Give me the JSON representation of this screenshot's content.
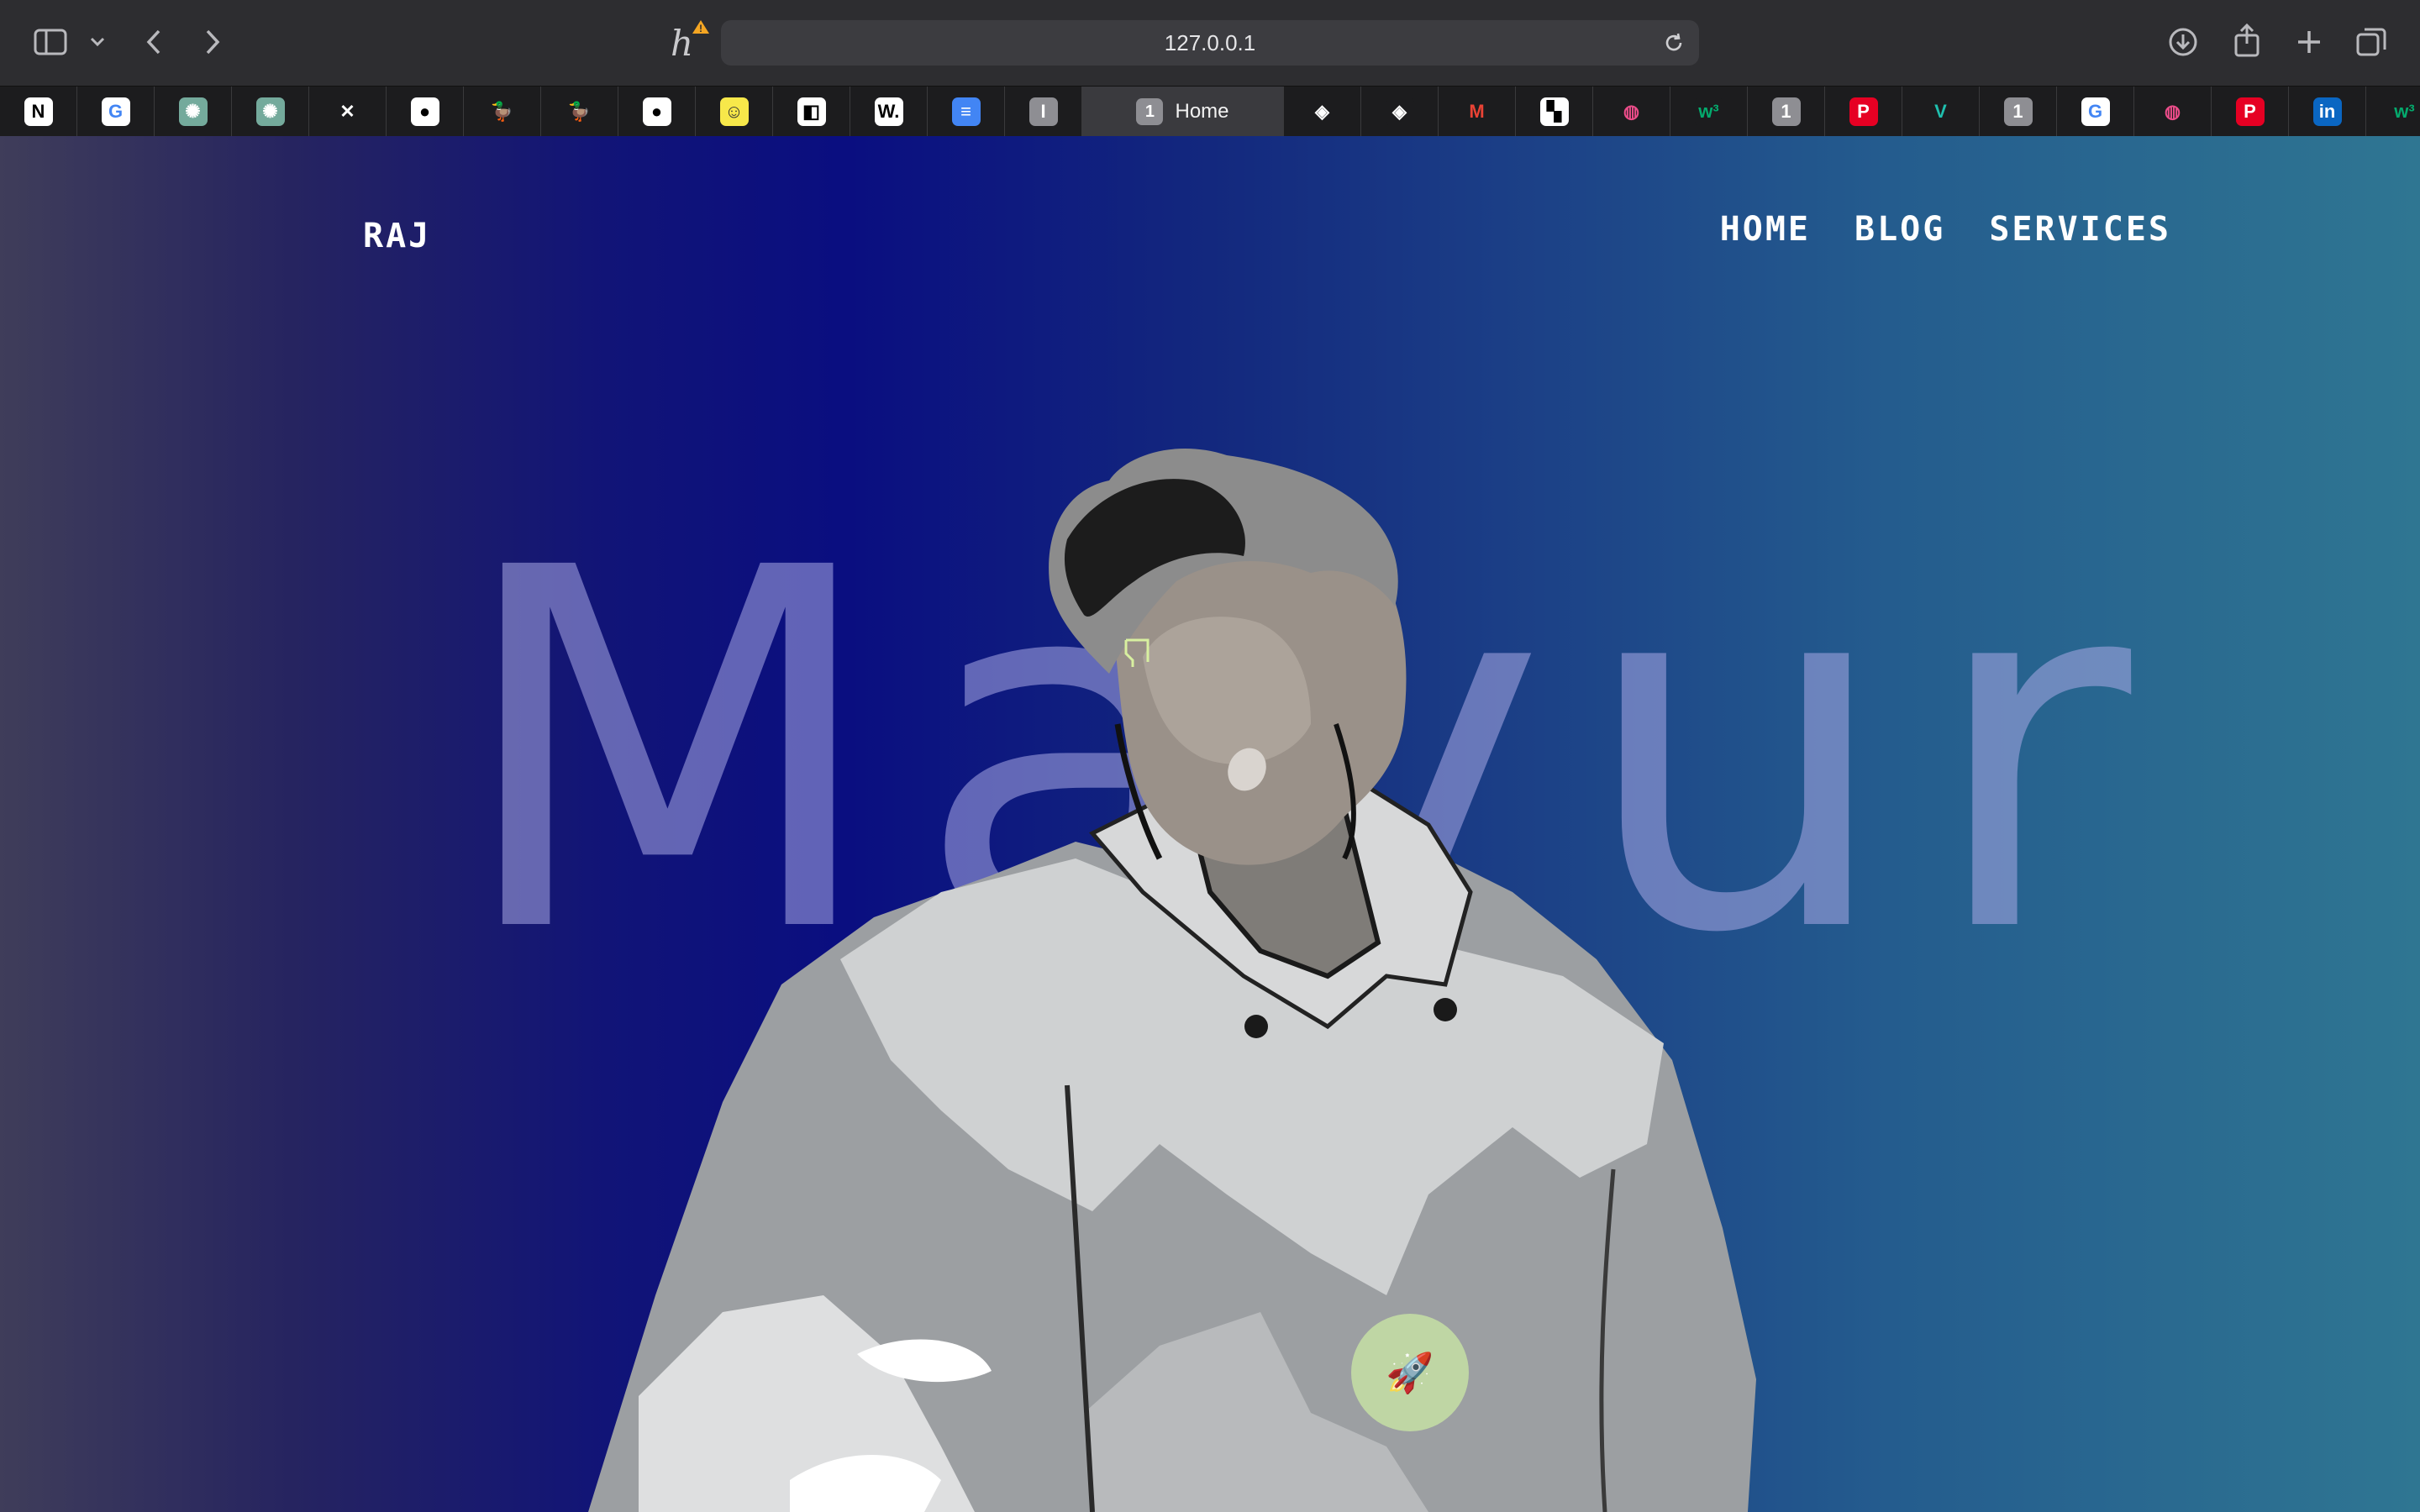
{
  "browser": {
    "url": "127.0.0.1",
    "active_tab": {
      "count": "1",
      "title": "Home"
    },
    "tabs_left": [
      {
        "icon": "notion-icon",
        "glyph": "N",
        "bg": "#ffffff",
        "fg": "#000000"
      },
      {
        "icon": "google-icon",
        "glyph": "G",
        "bg": "#ffffff",
        "fg": "#4285f4"
      },
      {
        "icon": "chatgpt-icon",
        "glyph": "✺",
        "bg": "#74aa9c",
        "fg": "#ffffff"
      },
      {
        "icon": "chatgpt-icon",
        "glyph": "✺",
        "bg": "#74aa9c",
        "fg": "#ffffff"
      },
      {
        "icon": "framer-icon",
        "glyph": "✕",
        "bg": "#1c1c1e",
        "fg": "#ffffff"
      },
      {
        "icon": "github-icon",
        "glyph": "●",
        "bg": "#ffffff",
        "fg": "#000000"
      },
      {
        "icon": "duckduckgo-icon",
        "glyph": "🦆",
        "bg": "#1c1c1e",
        "fg": "#ffffff"
      },
      {
        "icon": "duckduckgo-icon",
        "glyph": "🦆",
        "bg": "#1c1c1e",
        "fg": "#ffffff"
      },
      {
        "icon": "github-icon",
        "glyph": "●",
        "bg": "#ffffff",
        "fg": "#000000"
      },
      {
        "icon": "smiley-icon",
        "glyph": "☺",
        "bg": "#f7e84a",
        "fg": "#333333"
      },
      {
        "icon": "squarespace-icon",
        "glyph": "◧",
        "bg": "#ffffff",
        "fg": "#000000"
      },
      {
        "icon": "webflow-w-icon",
        "glyph": "W.",
        "bg": "#ffffff",
        "fg": "#000000"
      },
      {
        "icon": "google-docs-icon",
        "glyph": "≡",
        "bg": "#4285f4",
        "fg": "#ffffff"
      },
      {
        "icon": "generic-tab-icon",
        "glyph": "I",
        "bg": "#8e8e93",
        "fg": "#ffffff"
      }
    ],
    "tabs_right": [
      {
        "icon": "codepen-icon",
        "glyph": "◈",
        "bg": "#1c1c1e",
        "fg": "#ffffff"
      },
      {
        "icon": "codepen-icon",
        "glyph": "◈",
        "bg": "#1c1c1e",
        "fg": "#ffffff"
      },
      {
        "icon": "gmail-icon",
        "glyph": "M",
        "bg": "#1c1c1e",
        "fg": "#ea4335"
      },
      {
        "icon": "checker-icon",
        "glyph": "▚",
        "bg": "#ffffff",
        "fg": "#000000"
      },
      {
        "icon": "dribbble-icon",
        "glyph": "◍",
        "bg": "#1c1c1e",
        "fg": "#ea4c89"
      },
      {
        "icon": "w3schools-icon",
        "glyph": "w³",
        "bg": "#1c1c1e",
        "fg": "#04aa6d"
      },
      {
        "icon": "generic-tab-icon",
        "glyph": "1",
        "bg": "#8e8e93",
        "fg": "#ffffff"
      },
      {
        "icon": "pinterest-icon",
        "glyph": "P",
        "bg": "#e60023",
        "fg": "#ffffff"
      },
      {
        "icon": "vuetify-icon",
        "glyph": "V",
        "bg": "#1c1c1e",
        "fg": "#1fbfae"
      },
      {
        "icon": "generic-tab-icon",
        "glyph": "1",
        "bg": "#8e8e93",
        "fg": "#ffffff"
      },
      {
        "icon": "google-icon",
        "glyph": "G",
        "bg": "#ffffff",
        "fg": "#4285f4"
      },
      {
        "icon": "dribbble-icon",
        "glyph": "◍",
        "bg": "#1c1c1e",
        "fg": "#ea4c89"
      },
      {
        "icon": "pinterest-icon",
        "glyph": "P",
        "bg": "#e60023",
        "fg": "#ffffff"
      },
      {
        "icon": "linkedin-icon",
        "glyph": "in",
        "bg": "#0a66c2",
        "fg": "#ffffff"
      },
      {
        "icon": "w3schools-icon",
        "glyph": "w³",
        "bg": "#1c1c1e",
        "fg": "#04aa6d"
      }
    ]
  },
  "page": {
    "brand": "RAJ",
    "nav": {
      "home": "HOME",
      "blog": "BLOG",
      "services": "SERVICES"
    },
    "hero_name": "Mayur",
    "rocket_glyph": "🚀"
  },
  "colors": {
    "accent": "#0a0e80",
    "rocket_bg": "#bfd6a4"
  }
}
